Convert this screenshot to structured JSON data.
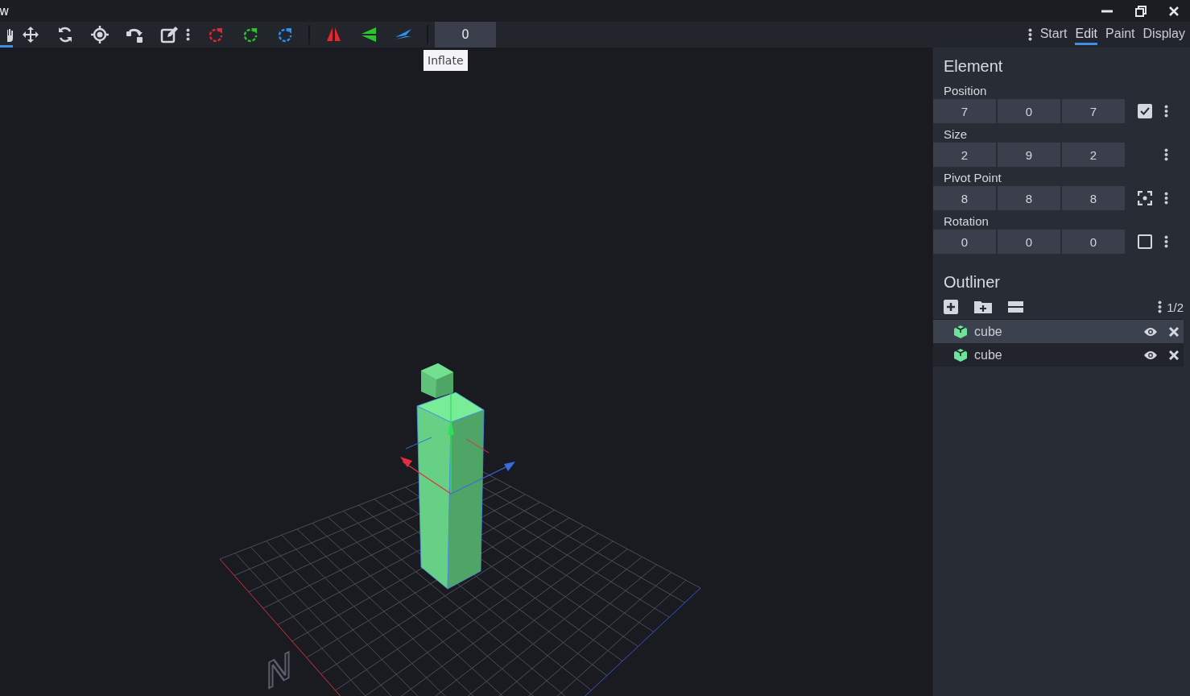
{
  "menu": {
    "label": "w"
  },
  "toolbar": {
    "tools": [
      {
        "kind": "hand",
        "selected": true
      },
      {
        "kind": "move",
        "selected": false
      },
      {
        "kind": "rotate",
        "selected": false
      },
      {
        "kind": "pivot",
        "selected": false
      },
      {
        "kind": "snap",
        "selected": false
      },
      {
        "kind": "edit",
        "selected": false
      }
    ],
    "rotate_axes": [
      {
        "color": "#e0282e"
      },
      {
        "color": "#2bc52b"
      },
      {
        "color": "#2f8ff0"
      }
    ],
    "mirror_axes": [
      {
        "color": "#e0282e"
      },
      {
        "color": "#2bc52b"
      },
      {
        "color": "#2f8ff0"
      }
    ],
    "inflate": {
      "value": "0",
      "tooltip": "Inflate"
    }
  },
  "mode_tabs": [
    {
      "label": "Start",
      "selected": false
    },
    {
      "label": "Edit",
      "selected": true
    },
    {
      "label": "Paint",
      "selected": false
    },
    {
      "label": "Display",
      "selected": false
    }
  ],
  "element": {
    "title": "Element",
    "rows": [
      {
        "label": "Position",
        "values": [
          "7",
          "0",
          "7"
        ],
        "kind": "checkbox",
        "checked": true
      },
      {
        "label": "Size",
        "values": [
          "2",
          "9",
          "2"
        ],
        "kind": "plain"
      },
      {
        "label": "Pivot Point",
        "values": [
          "8",
          "8",
          "8"
        ],
        "kind": "center"
      },
      {
        "label": "Rotation",
        "values": [
          "0",
          "0",
          "0"
        ],
        "kind": "checkbox",
        "checked": false
      }
    ]
  },
  "outliner": {
    "title": "Outliner",
    "count": "1/2",
    "items": [
      {
        "name": "cube",
        "selected": true
      },
      {
        "name": "cube",
        "selected": false
      }
    ]
  },
  "viewport": {
    "compass_label": "N"
  }
}
